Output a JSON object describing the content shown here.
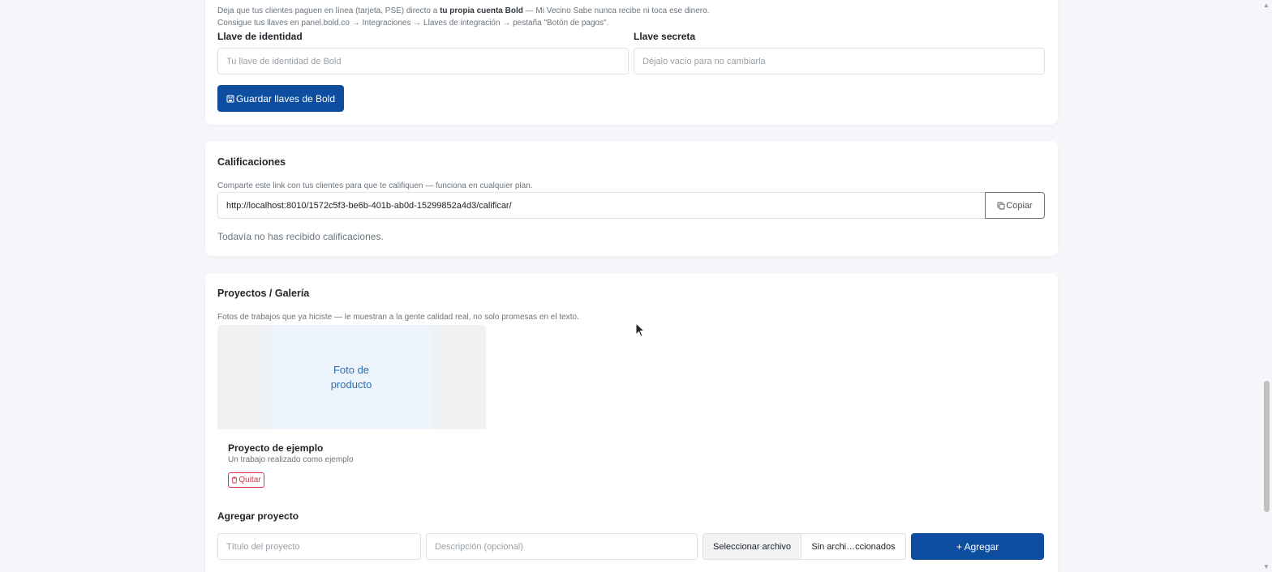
{
  "bold": {
    "description_prefix": "Deja que tus clientes paguen en línea (tarjeta, PSE) directo a ",
    "description_bold": "tu propia cuenta Bold",
    "description_suffix": " — Mi Vecino Sabe nunca recibe ni toca ese dinero.",
    "instructions": "Consigue tus llaves en panel.bold.co → Integraciones → Llaves de integración → pestaña \"Botón de pagos\".",
    "identity_label": "Llave de identidad",
    "identity_placeholder": "Tu llave de identidad de Bold",
    "secret_label": "Llave secreta",
    "secret_placeholder": "Déjalo vacío para no cambiarla",
    "save_button": "Guardar llaves de Bold"
  },
  "ratings": {
    "title": "Calificaciones",
    "description": "Comparte este link con tus clientes para que te califiquen — funciona en cualquier plan.",
    "link_value": "http://localhost:8010/1572c5f3-be6b-401b-ab0d-15299852a4d3/calificar/",
    "copy_button": "Copiar",
    "empty_message": "Todavía no has recibido calificaciones."
  },
  "projects": {
    "title": "Proyectos / Galería",
    "description": "Fotos de trabajos que ya hiciste — le muestran a la gente calidad real, no solo promesas en el texto.",
    "items": [
      {
        "photo_line1": "Foto de",
        "photo_line2": "producto",
        "name": "Proyecto de ejemplo",
        "description": "Un trabajo realizado como ejemplo",
        "remove_button": "Quitar"
      }
    ],
    "add_title": "Agregar proyecto",
    "title_placeholder": "Título del proyecto",
    "desc_placeholder": "Descripción (opcional)",
    "file_button": "Seleccionar archivo",
    "file_status": "Sin archi…ccionados",
    "add_button": "+ Agregar"
  },
  "colors": {
    "primary": "#0d4ea0",
    "danger": "#dc3545",
    "photo_bg": "#eef4fb",
    "photo_text": "#2f6fb0"
  }
}
